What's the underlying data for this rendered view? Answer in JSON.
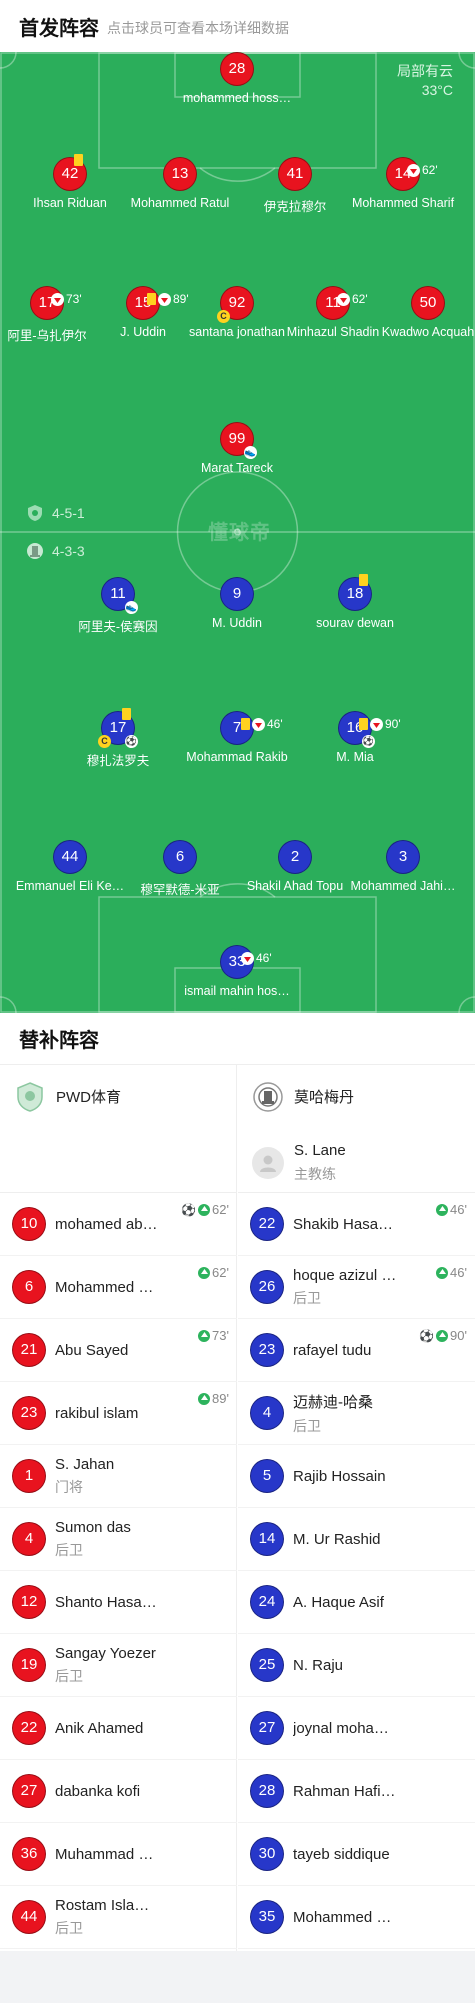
{
  "header": {
    "title": "首发阵容",
    "subtitle": "点击球员可查看本场详细数据"
  },
  "weather": {
    "condition": "局部有云",
    "temp": "33°C"
  },
  "watermark": "懂球帝",
  "formations": {
    "home": "4-5-1",
    "away": "4-3-3"
  },
  "colors": {
    "pitch": "#2bae5b",
    "home": "#e8131f",
    "away": "#2737c9",
    "card": "#ffd21f"
  },
  "home_lineup": [
    {
      "num": "28",
      "name": "mohammed hoss…"
    },
    {
      "num": "42",
      "name": "Ihsan Riduan",
      "card": true
    },
    {
      "num": "13",
      "name": "Mohammed Ratul"
    },
    {
      "num": "41",
      "name": "伊克拉穆尔"
    },
    {
      "num": "14",
      "name": "Mohammed Sharif",
      "sub": "62'"
    },
    {
      "num": "17",
      "name": "阿里-乌扎伊尔",
      "sub": "73'"
    },
    {
      "num": "15",
      "name": "J. Uddin",
      "card": true,
      "sub": "89'"
    },
    {
      "num": "92",
      "name": "santana jonathan",
      "captain": "C"
    },
    {
      "num": "11",
      "name": "Minhazul Shadin",
      "sub": "62'"
    },
    {
      "num": "50",
      "name": "Kwadwo Acquah"
    },
    {
      "num": "99",
      "name": "Marat Tareck",
      "boot": true
    }
  ],
  "away_lineup": [
    {
      "num": "11",
      "name": "阿里夫-侯赛因",
      "boot": true
    },
    {
      "num": "9",
      "name": "M. Uddin"
    },
    {
      "num": "18",
      "name": "sourav dewan",
      "card": true
    },
    {
      "num": "17",
      "name": "穆扎法罗夫",
      "card": true,
      "captain": "C",
      "goal": true
    },
    {
      "num": "7",
      "name": "Mohammad Rakib",
      "card": true,
      "sub": "46'"
    },
    {
      "num": "16",
      "name": "M. Mia",
      "card": true,
      "sub": "90'",
      "goal": true
    },
    {
      "num": "44",
      "name": "Emmanuel Eli Ke…"
    },
    {
      "num": "6",
      "name": "穆罕默德-米亚"
    },
    {
      "num": "2",
      "name": "Shakil Ahad Topu"
    },
    {
      "num": "3",
      "name": "Mohammed Jahi…"
    },
    {
      "num": "33",
      "name": "ismail mahin hos…",
      "sub": "46'"
    }
  ],
  "subs": {
    "title": "替补阵容",
    "home_team": "PWD体育",
    "away_team": "莫哈梅丹",
    "away_coach": {
      "name": "S. Lane",
      "role": "主教练"
    },
    "home": [
      {
        "num": "10",
        "name": "mohamed ab…",
        "goal": true,
        "minute": "62'"
      },
      {
        "num": "6",
        "name": "Mohammed …",
        "minute": "62'"
      },
      {
        "num": "21",
        "name": "Abu Sayed",
        "minute": "73'"
      },
      {
        "num": "23",
        "name": "rakibul islam",
        "minute": "89'"
      },
      {
        "num": "1",
        "name": "S. Jahan",
        "role": "门将"
      },
      {
        "num": "4",
        "name": "Sumon das",
        "role": "后卫"
      },
      {
        "num": "12",
        "name": "Shanto Hasa…"
      },
      {
        "num": "19",
        "name": "Sangay Yoezer",
        "role": "后卫"
      },
      {
        "num": "22",
        "name": "Anik Ahamed"
      },
      {
        "num": "27",
        "name": "dabanka kofi"
      },
      {
        "num": "36",
        "name": "Muhammad …"
      },
      {
        "num": "44",
        "name": "Rostam Isla…",
        "role": "后卫"
      }
    ],
    "away": [
      {
        "num": "22",
        "name": "Shakib Hasa…",
        "minute": "46'"
      },
      {
        "num": "26",
        "name": "hoque azizul …",
        "role": "后卫",
        "minute": "46'"
      },
      {
        "num": "23",
        "name": "rafayel tudu",
        "goal": true,
        "minute": "90'"
      },
      {
        "num": "4",
        "name": "迈赫迪-哈桑",
        "role": "后卫"
      },
      {
        "num": "5",
        "name": "Rajib Hossain"
      },
      {
        "num": "14",
        "name": "M. Ur Rashid"
      },
      {
        "num": "24",
        "name": "A. Haque Asif"
      },
      {
        "num": "25",
        "name": "N. Raju"
      },
      {
        "num": "27",
        "name": "joynal moha…"
      },
      {
        "num": "28",
        "name": "Rahman Hafi…"
      },
      {
        "num": "30",
        "name": "tayeb siddique"
      },
      {
        "num": "35",
        "name": "Mohammed …"
      }
    ]
  }
}
